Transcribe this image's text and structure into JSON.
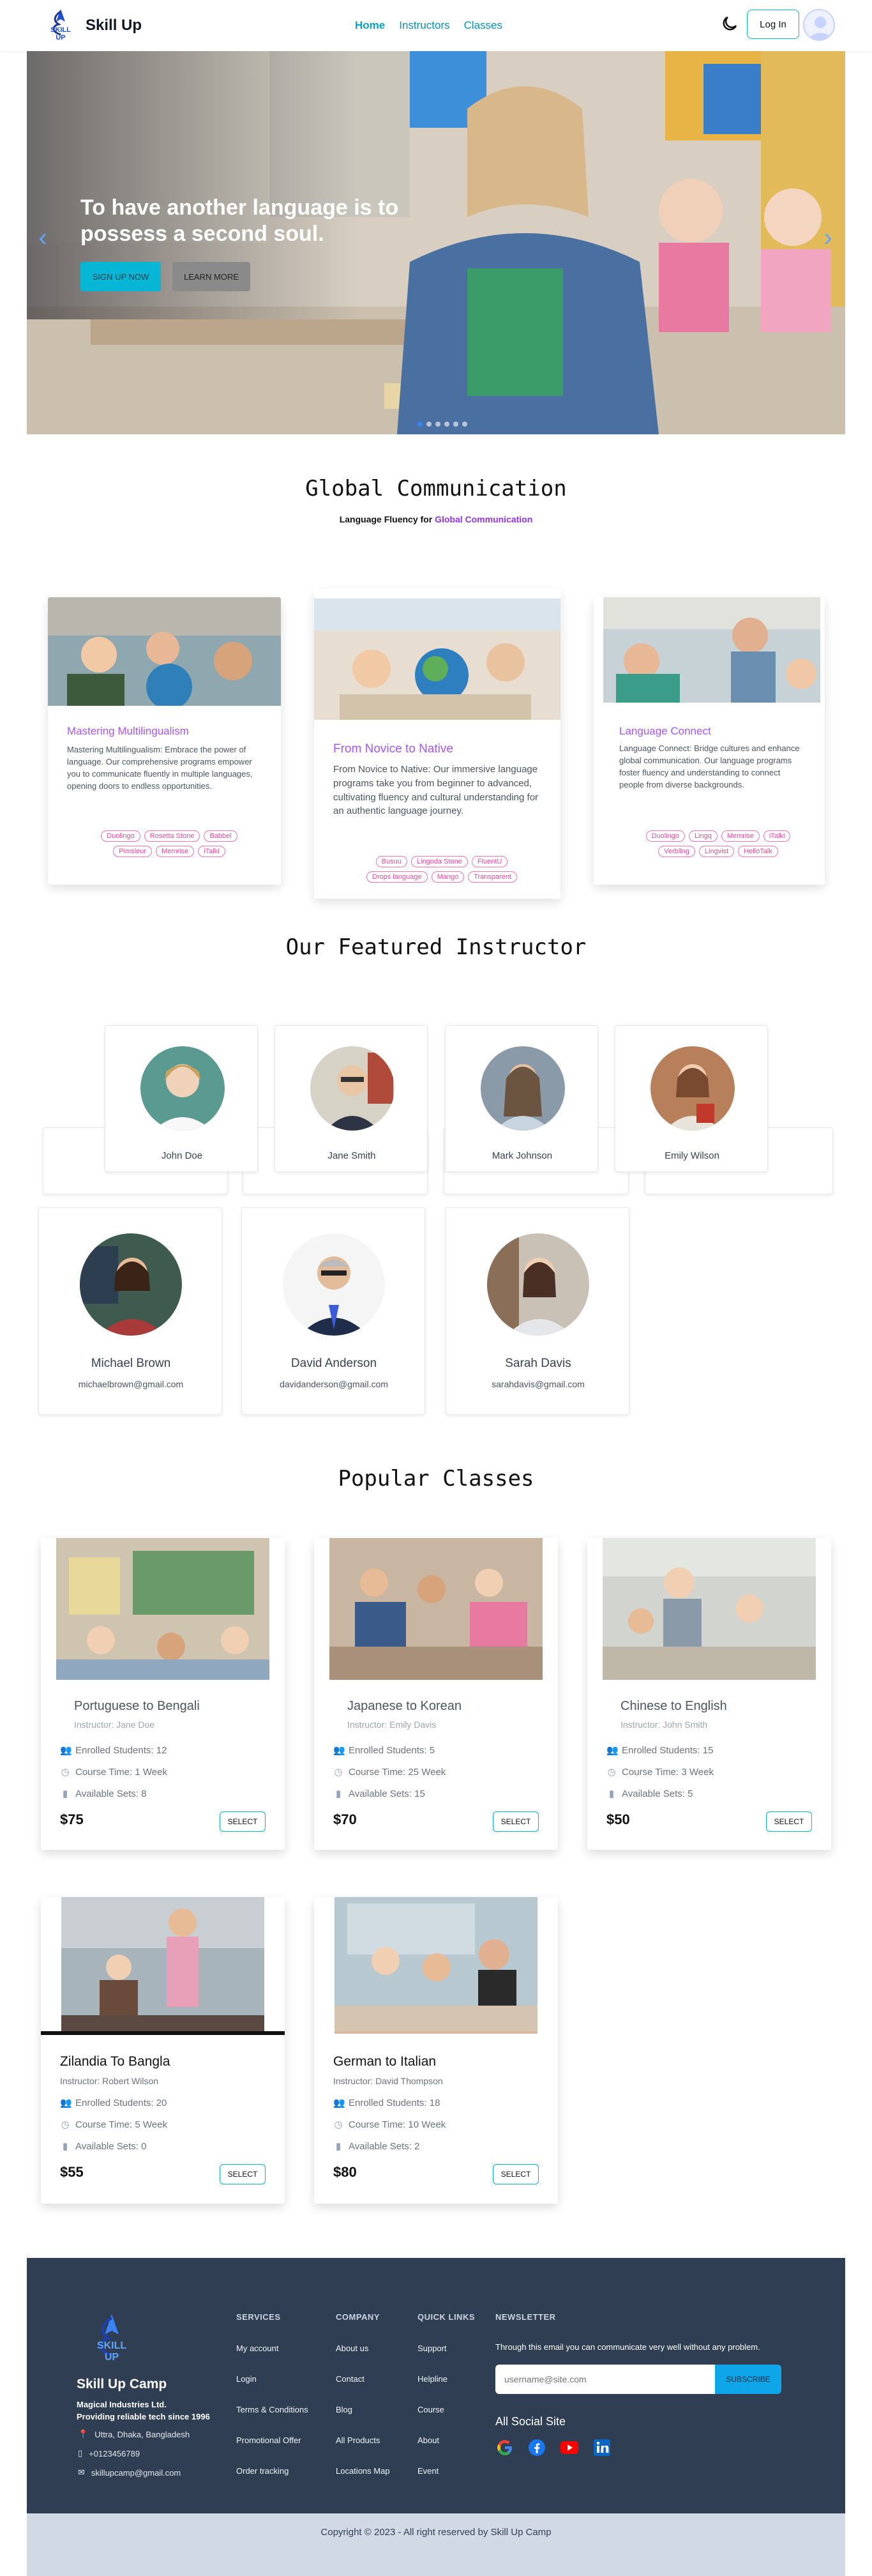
{
  "nav": {
    "brand": "Skill Up",
    "logo_text": "SKILL UP",
    "menu": [
      "Home",
      "Instructors",
      "Classes"
    ],
    "login": "Log In"
  },
  "hero": {
    "title": "To have another language is to possess a second soul.",
    "btn_primary": "SIGN UP NOW",
    "btn_secondary": "LEARN MORE",
    "slides": 6,
    "active_slide": 1
  },
  "global": {
    "title": "Global Communication",
    "subtitle_prefix": "Language Fluency for ",
    "subtitle_highlight": "Global Communication",
    "cards": [
      {
        "title": "Mastering Multilingualism",
        "text": "Mastering Multilingualism: Embrace the power of language. Our comprehensive programs empower you to communicate fluently in multiple languages, opening doors to endless opportunities.",
        "tags": [
          "Duolingo",
          "Rosetta Stone",
          "Babbel",
          "Pimsleur",
          "Memrise",
          "iTalki"
        ]
      },
      {
        "title": "From Novice to Native",
        "text": "From Novice to Native: Our immersive language programs take you from beginner to advanced, cultivating fluency and cultural understanding for an authentic language journey.",
        "tags": [
          "Busuu",
          "Lingoda Stone",
          "FluentU",
          "Drops language",
          "Mango",
          "Transparent"
        ]
      },
      {
        "title": "Language Connect",
        "text": "Language Connect: Bridge cultures and enhance global communication. Our language programs foster fluency and understanding to connect people from diverse backgrounds.",
        "tags": [
          "Duolingo",
          "Lingq",
          "Memrise",
          "iTalki",
          "Verbling",
          "Lingvist",
          "HelloTalk"
        ]
      }
    ]
  },
  "instructors": {
    "title": "Our Featured Instructor",
    "top": [
      {
        "name": "John Doe"
      },
      {
        "name": "Jane Smith"
      },
      {
        "name": "Mark Johnson"
      },
      {
        "name": "Emily Wilson"
      }
    ],
    "bottom": [
      {
        "name": "Michael Brown",
        "email": "michaelbrown@gmail.com"
      },
      {
        "name": "David Anderson",
        "email": "davidanderson@gmail.com"
      },
      {
        "name": "Sarah Davis",
        "email": "sarahdavis@gmail.com"
      }
    ]
  },
  "classes": {
    "title": "Popular Classes",
    "select_label": "SELECT",
    "items": [
      {
        "title": "Portuguese to Bengali",
        "instructor": "Instructor: Jane Doe",
        "enrolled": "Enrolled Students: 12",
        "time": "Course Time: 1 Week",
        "sets": "Available Sets: 8",
        "price": "$75"
      },
      {
        "title": "Japanese to Korean",
        "instructor": "Instructor: Emily Davis",
        "enrolled": "Enrolled Students: 5",
        "time": "Course Time: 25 Week",
        "sets": "Available Sets: 15",
        "price": "$70"
      },
      {
        "title": "Chinese to English",
        "instructor": "Instructor: John Smith",
        "enrolled": "Enrolled Students: 15",
        "time": "Course Time: 3 Week",
        "sets": "Available Sets: 5",
        "price": "$50"
      },
      {
        "title": "Zilandia To Bangla",
        "instructor": "Instructor: Robert Wilson",
        "enrolled": "Enrolled Students: 20",
        "time": "Course Time: 5 Week",
        "sets": "Available Sets: 0",
        "price": "$55"
      },
      {
        "title": "German to Italian",
        "instructor": "Instructor: David Thompson",
        "enrolled": "Enrolled Students: 18",
        "time": "Course Time: 10 Week",
        "sets": "Available Sets: 2",
        "price": "$80"
      }
    ]
  },
  "footer": {
    "camp": "Skill Up Camp",
    "company": "Magical Industries Ltd.",
    "tagline": "Providing reliable tech since 1996",
    "address": "Uttra, Dhaka, Bangladesh",
    "phone": "+0123456789",
    "email": "skillupcamp@gmail.com",
    "services_h": "SERVICES",
    "services": [
      "My account",
      "Login",
      "Terms & Conditions",
      "Promotional Offer",
      "Order tracking"
    ],
    "company_h": "COMPANY",
    "company_links": [
      "About us",
      "Contact",
      "Blog",
      "All Products",
      "Locations Map"
    ],
    "quick_h": "QUICK LINKS",
    "quick": [
      "Support",
      "Helpline",
      "Course",
      "About",
      "Event"
    ],
    "newsletter_h": "NEWSLETTER",
    "newsletter_text": "Through this email you can communicate very well without any problem.",
    "newsletter_placeholder": "username@site.com",
    "subscribe": "SUBSCRIBE",
    "social_h": "All Social Site",
    "copyright": "Copyright © 2023 - All right reserved by Skill Up Camp"
  },
  "colors": {
    "accent": "#06b6d4",
    "purple": "#a855f7",
    "footer_bg": "#2f3e52"
  }
}
